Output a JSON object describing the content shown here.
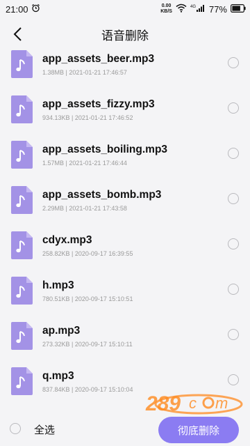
{
  "status_bar": {
    "time": "21:00",
    "net_speed_value": "0.00",
    "net_speed_unit": "KB/S",
    "battery": "77%"
  },
  "nav": {
    "title": "语音删除"
  },
  "files": [
    {
      "name": "app_assets_beer.mp3",
      "meta": "1.38MB | 2021-01-21 17:46:57"
    },
    {
      "name": "app_assets_fizzy.mp3",
      "meta": "934.13KB | 2021-01-21 17:46:52"
    },
    {
      "name": "app_assets_boiling.mp3",
      "meta": "1.57MB | 2021-01-21 17:46:44"
    },
    {
      "name": "app_assets_bomb.mp3",
      "meta": "2.29MB | 2021-01-21 17:43:58"
    },
    {
      "name": "cdyx.mp3",
      "meta": "258.82KB | 2020-09-17 16:39:55"
    },
    {
      "name": "h.mp3",
      "meta": "780.51KB | 2020-09-17 15:10:51"
    },
    {
      "name": "ap.mp3",
      "meta": "273.32KB | 2020-09-17 15:10:11"
    },
    {
      "name": "q.mp3",
      "meta": "837.84KB | 2020-09-17 15:10:04"
    }
  ],
  "bottom": {
    "select_all_label": "全选",
    "delete_label": "彻底删除"
  },
  "colors": {
    "accent": "#8b7cf2",
    "file_icon": "#a392e6",
    "background": "#f4f4f6"
  }
}
